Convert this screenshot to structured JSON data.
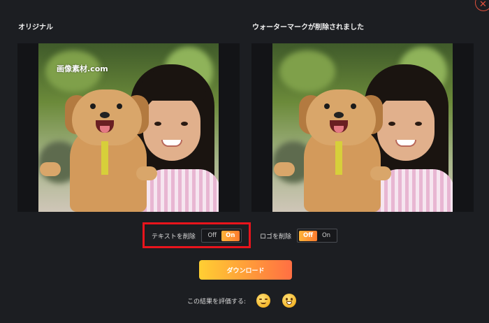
{
  "panels": {
    "original_title": "オリジナル",
    "result_title": "ウォーターマークが削除されました",
    "watermark_text": "画像素材.com"
  },
  "controls": {
    "text_remove": {
      "label": "テキストを削除",
      "off": "Off",
      "on": "On",
      "selected": "On"
    },
    "logo_remove": {
      "label": "ロゴを削除",
      "off": "Off",
      "on": "On",
      "selected": "Off"
    }
  },
  "download_label": "ダウンロード",
  "rating": {
    "label": "この結果を評価する:",
    "options": [
      "neutral-face-icon",
      "smiling-face-icon"
    ]
  },
  "close_icon": "close-icon",
  "colors": {
    "background": "#1c1e22",
    "accent_start": "#ffcf33",
    "accent_end": "#ff6f43",
    "highlight": "#e8141c"
  }
}
